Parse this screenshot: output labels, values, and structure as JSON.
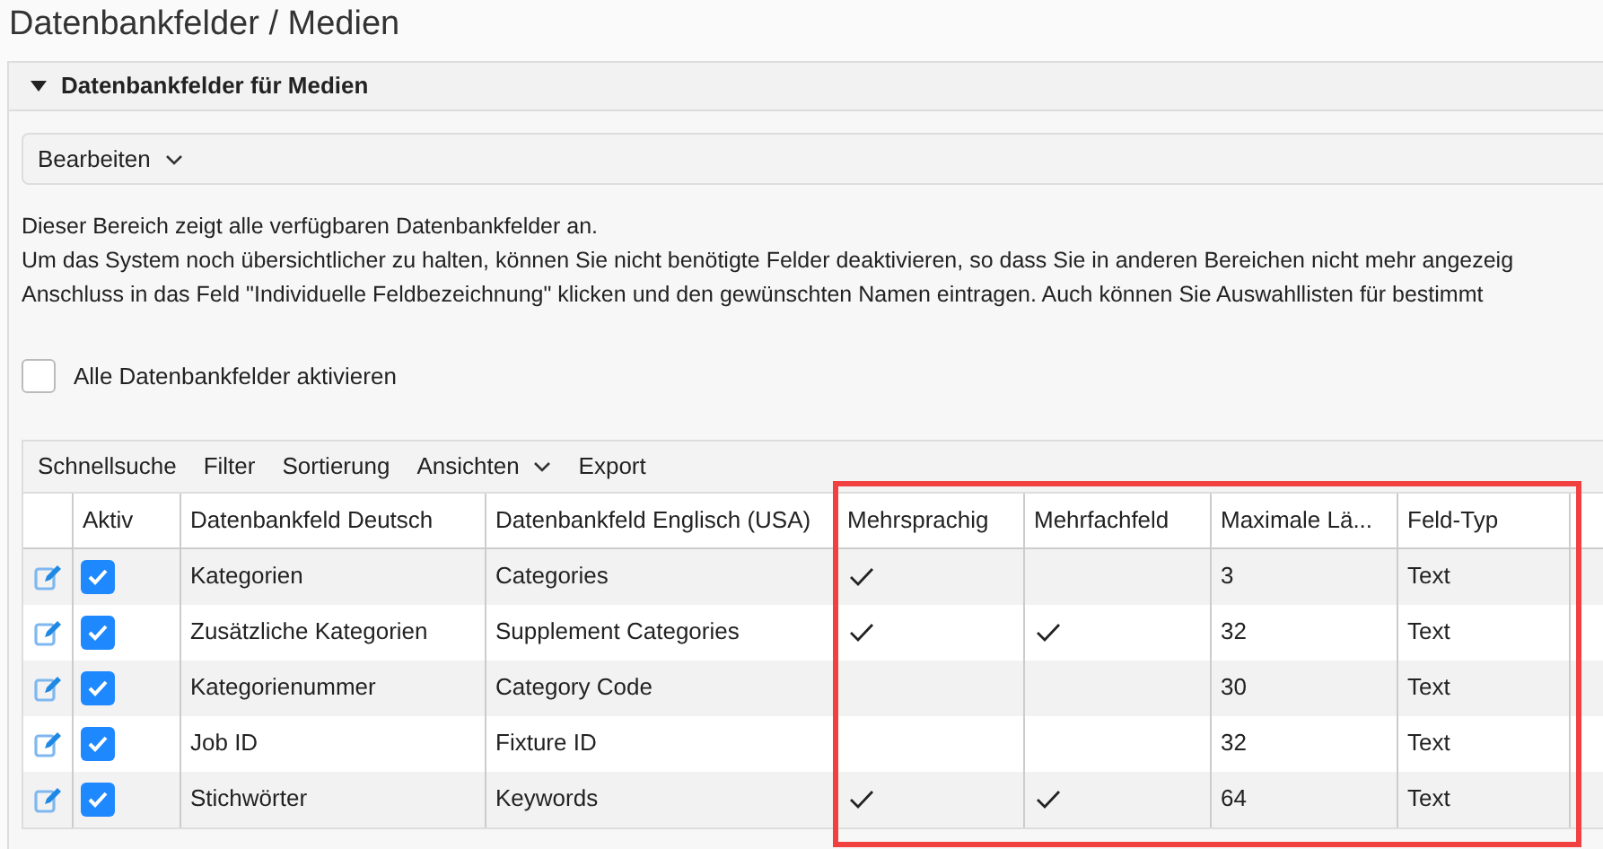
{
  "page_title": "Datenbankfelder / Medien",
  "panel": {
    "title": "Datenbankfelder für Medien",
    "expanded": true
  },
  "edit_menu": {
    "label": "Bearbeiten"
  },
  "description": [
    "Dieser Bereich zeigt alle verfügbaren Datenbankfelder an.",
    "Um das System noch übersichtlicher zu halten, können Sie nicht benötigte Felder deaktivieren, so dass Sie in anderen Bereichen nicht mehr angezeig",
    "Anschluss in das Feld \"Individuelle Feldbezeichnung\" klicken und den gewünschten Namen eintragen. Auch können Sie Auswahllisten für bestimmt"
  ],
  "activate_all": {
    "label": "Alle Datenbankfelder aktivieren",
    "checked": false
  },
  "toolbar": [
    {
      "label": "Schnellsuche",
      "kind": "plain"
    },
    {
      "label": "Filter",
      "kind": "plain"
    },
    {
      "label": "Sortierung",
      "kind": "plain"
    },
    {
      "label": "Ansichten",
      "kind": "dropdown"
    },
    {
      "label": "Export",
      "kind": "plain"
    }
  ],
  "table": {
    "columns": [
      "Aktiv",
      "Datenbankfeld Deutsch",
      "Datenbankfeld Englisch (USA)",
      "Mehrsprachig",
      "Mehrfachfeld",
      "Maximale Lä...",
      "Feld-Typ"
    ],
    "rows": [
      {
        "active": true,
        "german": "Kategorien",
        "english": "Categories",
        "multilingual": true,
        "multiple": false,
        "max_length": "3",
        "type": "Text"
      },
      {
        "active": true,
        "german": "Zusätzliche Kategorien",
        "english": "Supplement Categories",
        "multilingual": true,
        "multiple": true,
        "max_length": "32",
        "type": "Text"
      },
      {
        "active": true,
        "german": "Kategorienummer",
        "english": "Category Code",
        "multilingual": false,
        "multiple": false,
        "max_length": "30",
        "type": "Text"
      },
      {
        "active": true,
        "german": "Job ID",
        "english": "Fixture ID",
        "multilingual": false,
        "multiple": false,
        "max_length": "32",
        "type": "Text"
      },
      {
        "active": true,
        "german": "Stichwörter",
        "english": "Keywords",
        "multilingual": true,
        "multiple": true,
        "max_length": "64",
        "type": "Text"
      }
    ]
  }
}
